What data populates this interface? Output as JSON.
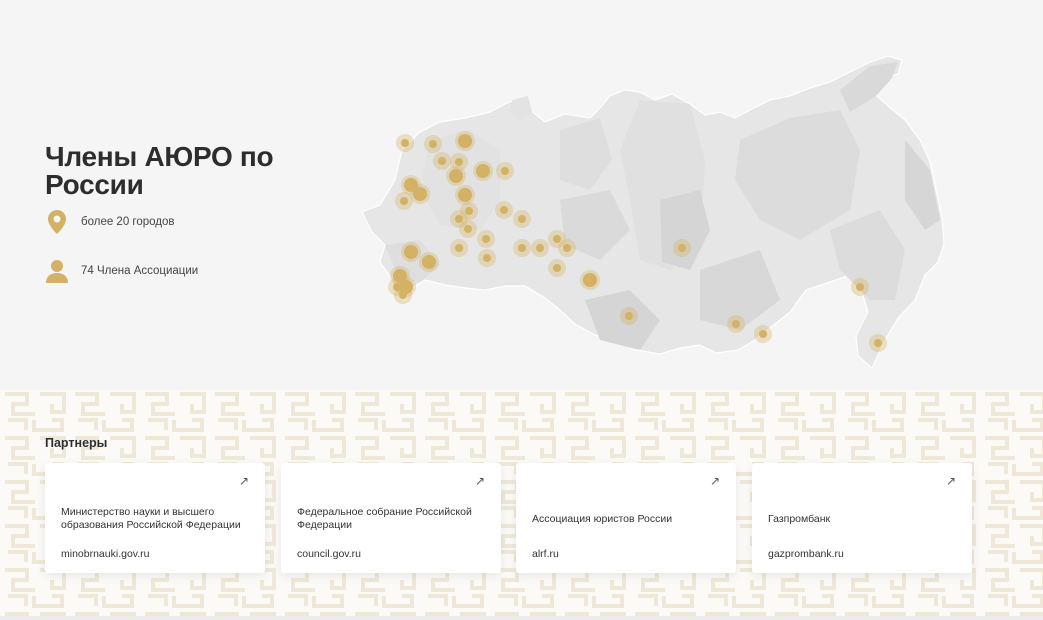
{
  "members": {
    "title": "Члены АЮРО по России",
    "cities_text": "более 20 городов",
    "members_text": "74 Члена Ассоциации",
    "icons": [
      "map-pin-icon",
      "person-icon"
    ],
    "accent_color": "#d4b265"
  },
  "partners": {
    "title": "Партнеры",
    "items": [
      {
        "name": "Министерство науки и высшего образования Российской Федерации",
        "link": "minobrnauki.gov.ru",
        "arrow": "↗"
      },
      {
        "name": "Федеральное собрание Российской Федерации",
        "link": "council.gov.ru",
        "arrow": "↗"
      },
      {
        "name": "Ассоциация юристов России",
        "link": "alrf.ru",
        "arrow": "↗"
      },
      {
        "name": "Газпромбанк",
        "link": "gazprombank.ru",
        "arrow": "↗"
      }
    ]
  }
}
